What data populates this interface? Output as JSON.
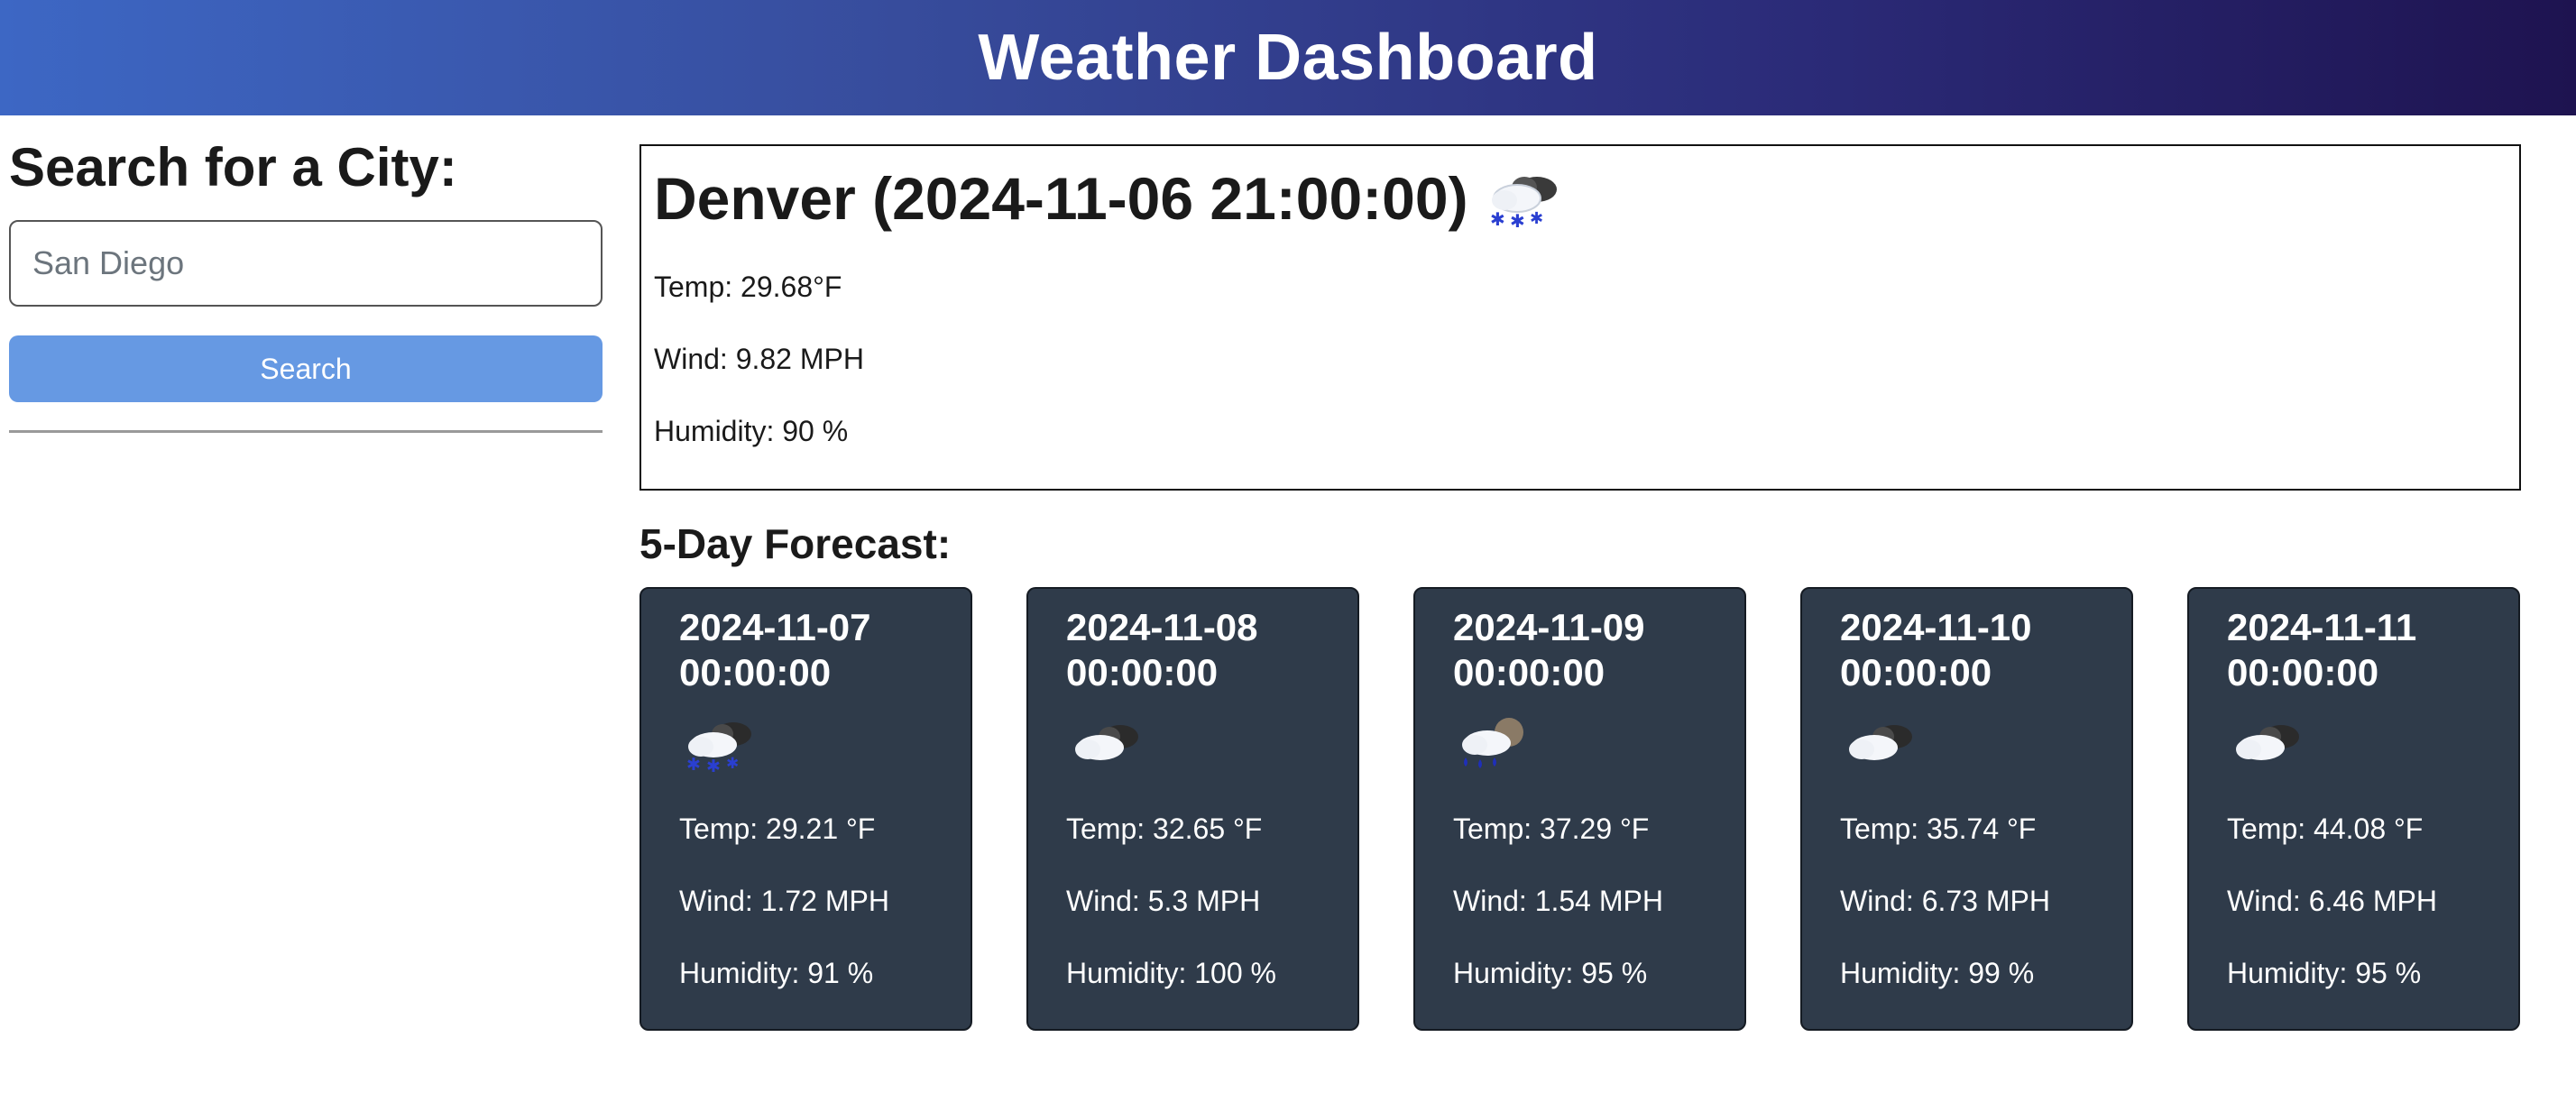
{
  "header": {
    "title": "Weather Dashboard"
  },
  "sidebar": {
    "heading": "Search for a City:",
    "search_input": {
      "value": "",
      "placeholder": "San Diego"
    },
    "search_button": "Search"
  },
  "current": {
    "title": "Denver (2024-11-06 21:00:00)",
    "icon": "snow-cloud-icon",
    "temp": "Temp: 29.68°F",
    "wind": "Wind: 9.82 MPH",
    "humidity": "Humidity: 90 %"
  },
  "forecast": {
    "heading": "5-Day Forecast:",
    "days": [
      {
        "date": "2024-11-07 00:00:00",
        "icon": "snow-cloud-icon",
        "temp": "Temp: 29.21 °F",
        "wind": "Wind: 1.72 MPH",
        "humidity": "Humidity: 91 %"
      },
      {
        "date": "2024-11-08 00:00:00",
        "icon": "cloudy-icon",
        "temp": "Temp: 32.65 °F",
        "wind": "Wind: 5.3 MPH",
        "humidity": "Humidity: 100 %"
      },
      {
        "date": "2024-11-09 00:00:00",
        "icon": "rain-cloud-icon",
        "temp": "Temp: 37.29 °F",
        "wind": "Wind: 1.54 MPH",
        "humidity": "Humidity: 95 %"
      },
      {
        "date": "2024-11-10 00:00:00",
        "icon": "cloudy-icon",
        "temp": "Temp: 35.74 °F",
        "wind": "Wind: 6.73 MPH",
        "humidity": "Humidity: 99 %"
      },
      {
        "date": "2024-11-11 00:00:00",
        "icon": "cloudy-icon",
        "temp": "Temp: 44.08 °F",
        "wind": "Wind: 6.46 MPH",
        "humidity": "Humidity: 95 %"
      }
    ]
  },
  "colors": {
    "header_gradient_start": "#3d67c4",
    "header_gradient_end": "#1e1350",
    "search_button": "#6699e3",
    "card_background": "#2f3b4a"
  }
}
